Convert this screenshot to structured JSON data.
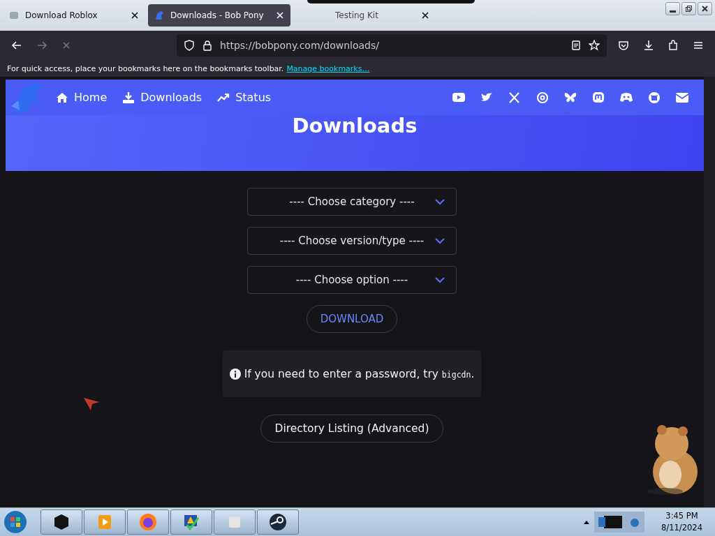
{
  "browser": {
    "tabs": [
      {
        "title": "Download Roblox",
        "selected": false
      },
      {
        "title": "Downloads - Bob Pony",
        "selected": true
      },
      {
        "title": "Testing Kit",
        "selected": false
      }
    ],
    "url": "https://bobpony.com/downloads/"
  },
  "bookmarks_bar": {
    "message": "For quick access, place your bookmarks here on the bookmarks toolbar.",
    "link": "Manage bookmarks…"
  },
  "site": {
    "nav": [
      {
        "label": "Home"
      },
      {
        "label": "Downloads"
      },
      {
        "label": "Status"
      }
    ],
    "heading": "Downloads",
    "selects": [
      {
        "placeholder": "---- Choose category ----"
      },
      {
        "placeholder": "---- Choose version/type ----"
      },
      {
        "placeholder": "---- Choose option ----"
      }
    ],
    "download_button": "DOWNLOAD",
    "notice": {
      "text": "If you need to enter a password, try ",
      "code": "bigcdn",
      "end": "."
    },
    "directory_button": "Directory Listing (Advanced)"
  },
  "taskbar": {
    "time": "3:45 PM",
    "date": "8/11/2024"
  }
}
